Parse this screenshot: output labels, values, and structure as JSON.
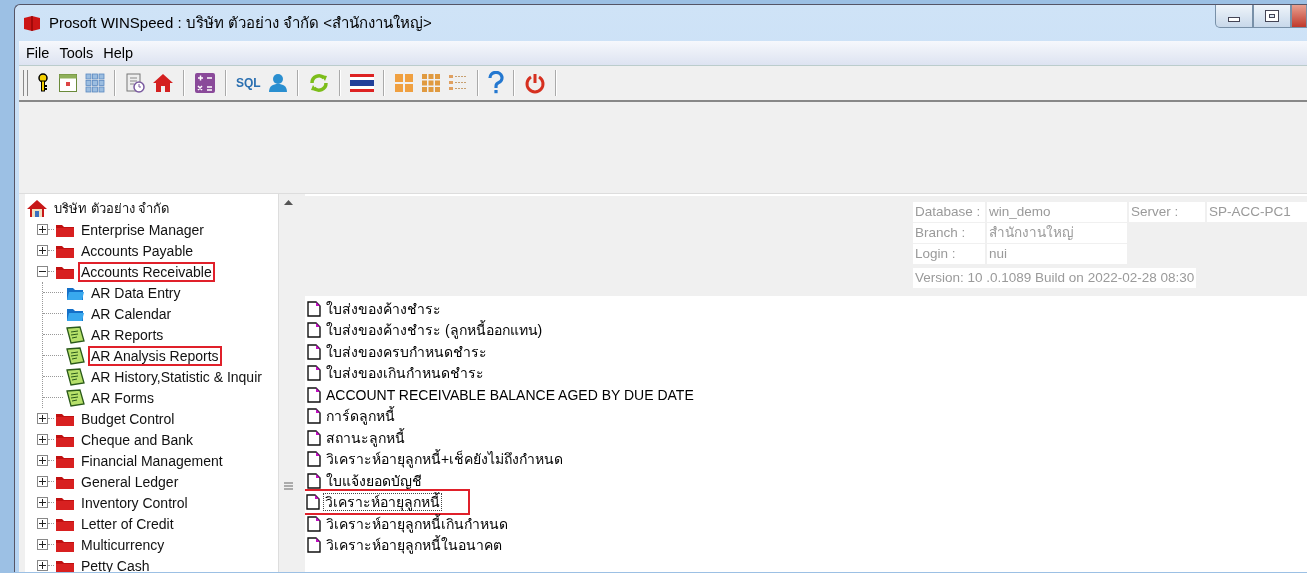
{
  "window": {
    "title": "Prosoft WINSpeed  :  บริษัท ตัวอย่าง จำกัด <สำนักงานใหญ่>"
  },
  "menu": [
    {
      "label": "File"
    },
    {
      "label": "Tools"
    },
    {
      "label": "Help"
    }
  ],
  "toolbar": {
    "sql_label": "SQL"
  },
  "tree": {
    "root": {
      "label": "บริษัท ตัวอย่าง จำกัด"
    },
    "items": [
      {
        "label": "Enterprise Manager",
        "kind": "module",
        "expanded": false,
        "highlighted": false
      },
      {
        "label": "Accounts Payable",
        "kind": "module",
        "expanded": false,
        "highlighted": false
      },
      {
        "label": "Accounts Receivable",
        "kind": "module",
        "expanded": true,
        "highlighted": true,
        "children": [
          {
            "label": "AR Data Entry",
            "kind": "folder",
            "highlighted": false
          },
          {
            "label": "AR Calendar",
            "kind": "folder",
            "highlighted": false
          },
          {
            "label": "AR Reports",
            "kind": "report",
            "highlighted": false
          },
          {
            "label": "AR Analysis Reports",
            "kind": "report",
            "highlighted": true
          },
          {
            "label": "AR History,Statistic & Inquir",
            "kind": "report",
            "highlighted": false
          },
          {
            "label": "AR Forms",
            "kind": "report",
            "highlighted": false
          }
        ]
      },
      {
        "label": "Budget Control",
        "kind": "module",
        "expanded": false,
        "highlighted": false
      },
      {
        "label": "Cheque and Bank",
        "kind": "module",
        "expanded": false,
        "highlighted": false
      },
      {
        "label": "Financial Management",
        "kind": "module",
        "expanded": false,
        "highlighted": false
      },
      {
        "label": "General Ledger",
        "kind": "module",
        "expanded": false,
        "highlighted": false
      },
      {
        "label": "Inventory Control",
        "kind": "module",
        "expanded": false,
        "highlighted": false
      },
      {
        "label": "Letter of Credit",
        "kind": "module",
        "expanded": false,
        "highlighted": false
      },
      {
        "label": "Multicurrency",
        "kind": "module",
        "expanded": false,
        "highlighted": false
      },
      {
        "label": "Petty Cash",
        "kind": "module",
        "expanded": false,
        "highlighted": false
      }
    ]
  },
  "info": {
    "database_label": "Database :",
    "database": "win_demo",
    "server_label": "Server :",
    "server": "SP-ACC-PC1",
    "branch_label": "Branch :",
    "branch": "สำนักงานใหญ่",
    "login_label": "Login :",
    "login": "nui",
    "version": "Version: 10 .0.1089  Build on 2022-02-28 08:30"
  },
  "reports": [
    {
      "label": "ใบส่งของค้างชำระ",
      "selected": false,
      "highlighted": false
    },
    {
      "label": "ใบส่งของค้างชำระ (ลูกหนี้ออกแทน)",
      "selected": false,
      "highlighted": false
    },
    {
      "label": "ใบส่งของครบกำหนดชำระ",
      "selected": false,
      "highlighted": false
    },
    {
      "label": "ใบส่งของเกินกำหนดชำระ",
      "selected": false,
      "highlighted": false
    },
    {
      "label": "ACCOUNT RECEIVABLE BALANCE AGED BY DUE DATE",
      "selected": false,
      "highlighted": false
    },
    {
      "label": "การ์ดลูกหนี้",
      "selected": false,
      "highlighted": false
    },
    {
      "label": "สถานะลูกหนี้",
      "selected": false,
      "highlighted": false
    },
    {
      "label": "วิเคราะห์อายุลูกหนี้+เช็คยังไม่ถึงกำหนด",
      "selected": false,
      "highlighted": false
    },
    {
      "label": "ใบแจ้งยอดบัญชี",
      "selected": false,
      "highlighted": false
    },
    {
      "label": "วิเคราะห์อายุลูกหนี้",
      "selected": true,
      "highlighted": true
    },
    {
      "label": "วิเคราะห์อายุลูกหนี้เกินกำหนด",
      "selected": false,
      "highlighted": false
    },
    {
      "label": "วิเคราะห์อายุลูกหนี้ในอนาคต",
      "selected": false,
      "highlighted": false
    }
  ]
}
